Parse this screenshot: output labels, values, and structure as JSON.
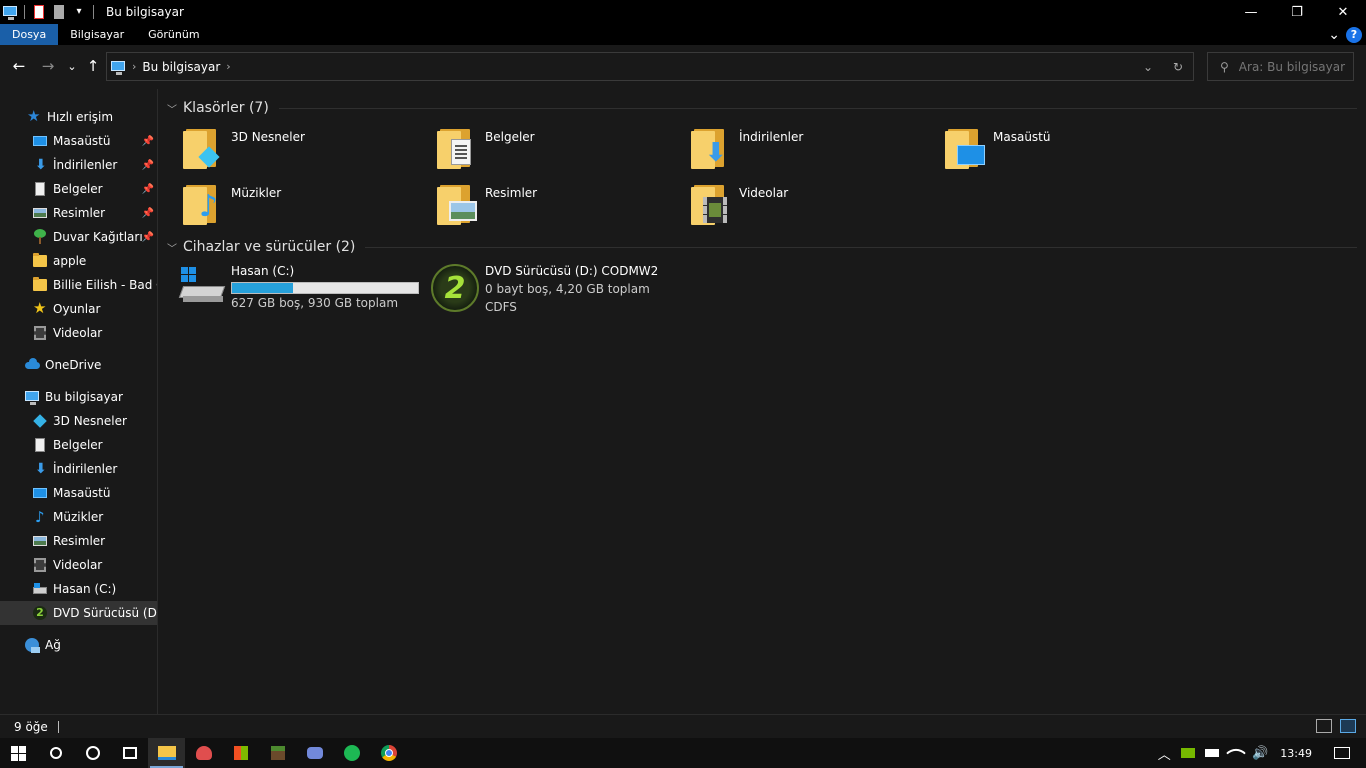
{
  "window": {
    "title": "Bu bilgisayar",
    "minimize": "—",
    "maximize": "❐",
    "close": "✕"
  },
  "ribbon": {
    "tabs": [
      "Dosya",
      "Bilgisayar",
      "Görünüm"
    ],
    "expand": "⌄",
    "help": "?"
  },
  "nav": {
    "back": "←",
    "forward": "→",
    "recent": "⌄",
    "up": "↑",
    "breadcrumb": "Bu bilgisayar",
    "crumb_chevron": "›",
    "dropdown": "⌄",
    "refresh": "↻",
    "search_placeholder": "Ara: Bu bilgisayar"
  },
  "sidebar": {
    "quick_access": {
      "label": "Hızlı erişim",
      "items": [
        {
          "label": "Masaüstü",
          "icon": "desktop-icon",
          "pinned": true
        },
        {
          "label": "İndirilenler",
          "icon": "download-icon",
          "pinned": true
        },
        {
          "label": "Belgeler",
          "icon": "document-icon",
          "pinned": true
        },
        {
          "label": "Resimler",
          "icon": "picture-icon",
          "pinned": true
        },
        {
          "label": "Duvar Kağıtları",
          "icon": "tree-icon",
          "pinned": true
        },
        {
          "label": "apple",
          "icon": "folder-icon",
          "pinned": false
        },
        {
          "label": "Billie Eilish - Bad Gu",
          "icon": "folder-icon",
          "pinned": false
        },
        {
          "label": "Oyunlar",
          "icon": "star-icon",
          "pinned": false
        },
        {
          "label": "Videolar",
          "icon": "video-icon",
          "pinned": false
        }
      ]
    },
    "onedrive": {
      "label": "OneDrive"
    },
    "this_pc": {
      "label": "Bu bilgisayar",
      "items": [
        {
          "label": "3D Nesneler",
          "icon": "cube-icon"
        },
        {
          "label": "Belgeler",
          "icon": "document-icon"
        },
        {
          "label": "İndirilenler",
          "icon": "download-icon"
        },
        {
          "label": "Masaüstü",
          "icon": "desktop-icon"
        },
        {
          "label": "Müzikler",
          "icon": "music-icon"
        },
        {
          "label": "Resimler",
          "icon": "picture-icon"
        },
        {
          "label": "Videolar",
          "icon": "video-icon"
        },
        {
          "label": "Hasan (C:)",
          "icon": "drive-icon"
        },
        {
          "label": "DVD Sürücüsü (D:) C",
          "icon": "mw2-icon"
        }
      ]
    },
    "network": {
      "label": "Ağ"
    },
    "pin_glyph": "📌"
  },
  "content": {
    "folders_header": "Klasörler (7)",
    "folders": [
      {
        "label": "3D Nesneler",
        "icon": "cube-icon"
      },
      {
        "label": "Belgeler",
        "icon": "document-icon"
      },
      {
        "label": "İndirilenler",
        "icon": "download-icon"
      },
      {
        "label": "Masaüstü",
        "icon": "desktop-icon"
      },
      {
        "label": "Müzikler",
        "icon": "music-icon"
      },
      {
        "label": "Resimler",
        "icon": "picture-icon"
      },
      {
        "label": "Videolar",
        "icon": "video-icon"
      }
    ],
    "drives_header": "Cihazlar ve sürücüler (2)",
    "drives": [
      {
        "label": "Hasan (C:)",
        "detail": "627 GB boş, 930 GB toplam",
        "used_fraction": 0.326
      },
      {
        "label": "DVD Sürücüsü (D:) CODMW2",
        "detail": "0 bayt boş, 4,20 GB toplam",
        "fs": "CDFS",
        "badge": "2"
      }
    ]
  },
  "status": {
    "count": "9 öğe"
  },
  "taskbar": {
    "clock": "13:49",
    "tray_chevron": "︿",
    "volume": "🔊"
  }
}
